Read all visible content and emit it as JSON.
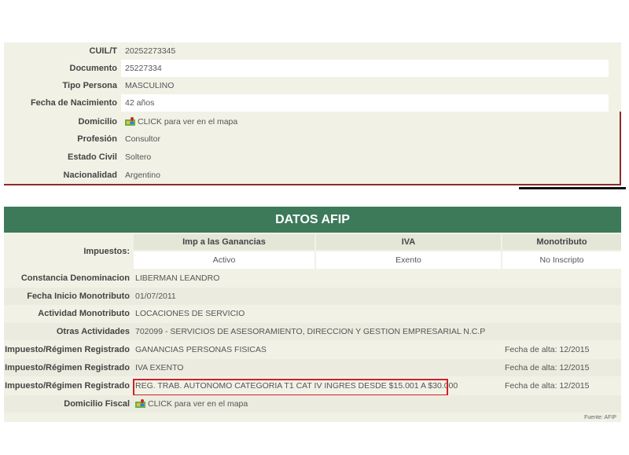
{
  "personal": {
    "rows": [
      {
        "label": "CUIL/T",
        "value": "20252273345"
      },
      {
        "label": "Documento",
        "value": "25227334"
      },
      {
        "label": "Tipo Persona",
        "value": "MASCULINO"
      },
      {
        "label": "Fecha de Nacimiento",
        "value": "42 años"
      },
      {
        "label": "Domicilio",
        "value": "CLICK para ver en el mapa"
      },
      {
        "label": "Profesión",
        "value": "Consultor"
      },
      {
        "label": "Estado Civil",
        "value": "Soltero"
      },
      {
        "label": "Nacionalidad",
        "value": "Argentino"
      }
    ]
  },
  "afip": {
    "title": "DATOS AFIP",
    "impuestos_label": "Impuestos:",
    "columns": [
      {
        "head": "Imp a las Ganancias",
        "value": "Activo"
      },
      {
        "head": "IVA",
        "value": "Exento"
      },
      {
        "head": "Monotributo",
        "value": "No Inscripto"
      }
    ],
    "rows": [
      {
        "label": "Constancia Denominacion",
        "value": "LIBERMAN LEANDRO",
        "fecha": ""
      },
      {
        "label": "Fecha Inicio Monotributo",
        "value": "01/07/2011",
        "fecha": ""
      },
      {
        "label": "Actividad Monotributo",
        "value": "LOCACIONES DE SERVICIO",
        "fecha": ""
      },
      {
        "label": "Otras Actividades",
        "value": "702099 - SERVICIOS DE ASESORAMIENTO, DIRECCION Y GESTION EMPRESARIAL N.C.P",
        "fecha": ""
      },
      {
        "label": "Impuesto/Régimen Registrado",
        "value": "GANANCIAS PERSONAS FISICAS",
        "fecha": "Fecha de alta: 12/2015"
      },
      {
        "label": "Impuesto/Régimen Registrado",
        "value": "IVA EXENTO",
        "fecha": "Fecha de alta: 12/2015"
      },
      {
        "label": "Impuesto/Régimen Registrado",
        "value": "REG. TRAB. AUTONOMO CATEGORIA T1 CAT IV INGRES DESDE $15.001 A $30.000",
        "fecha": "Fecha de alta: 12/2015"
      },
      {
        "label": "Domicilio Fiscal",
        "value": "CLICK para ver en el mapa",
        "fecha": ""
      }
    ],
    "source": "Fuente: AFIP"
  },
  "colors": {
    "header_green": "#3c7a5a",
    "highlight_red": "#d0202a",
    "border_maroon": "#8e2a2a"
  },
  "icons": {
    "map": "map-icon"
  }
}
